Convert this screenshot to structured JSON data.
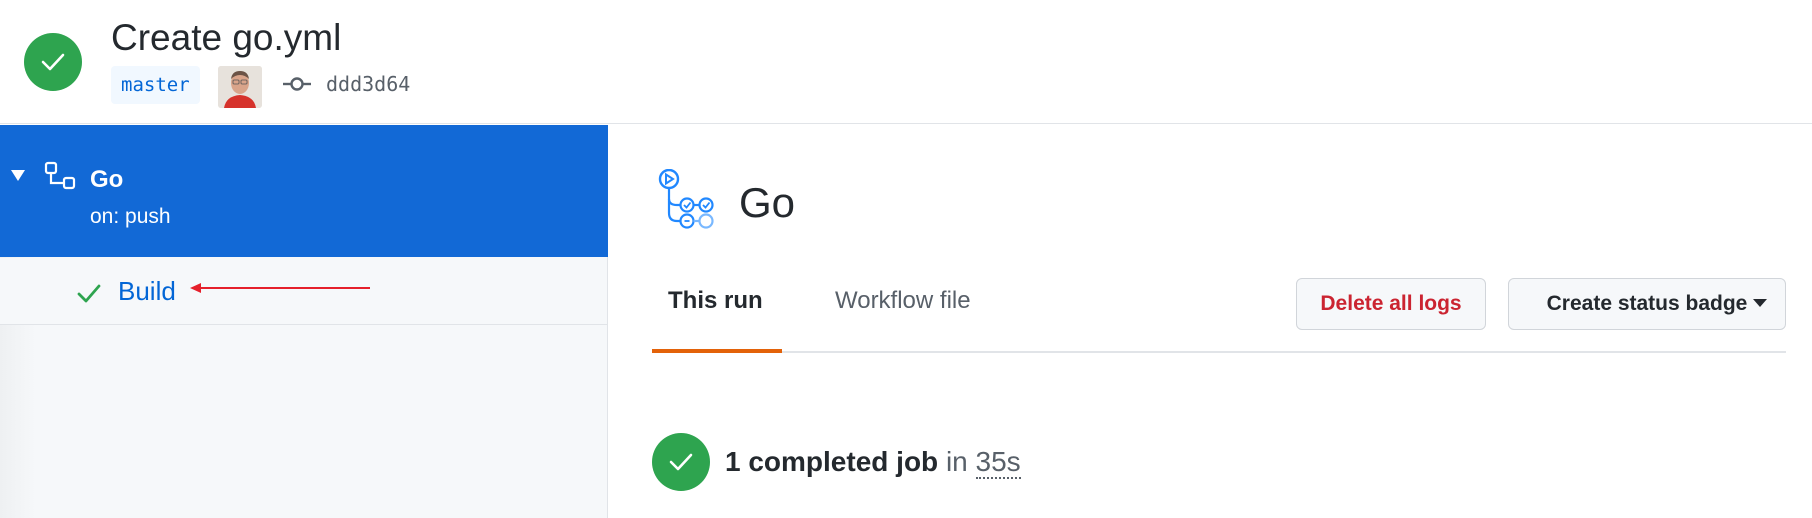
{
  "header": {
    "title": "Create go.yml",
    "branch": "master",
    "commit_sha": "ddd3d64",
    "status_icon": "check-icon",
    "commit_icon": "git-commit-icon"
  },
  "sidebar": {
    "workflow": {
      "name": "Go",
      "trigger": "on: push",
      "icon": "workflow-icon"
    },
    "jobs": [
      {
        "name": "Build",
        "status": "success",
        "icon": "check-icon"
      }
    ]
  },
  "main": {
    "title": "Go",
    "tabs": [
      {
        "label": "This run",
        "active": true
      },
      {
        "label": "Workflow file",
        "active": false
      }
    ],
    "buttons": {
      "delete_logs": "Delete all logs",
      "status_badge": "Create status badge"
    },
    "summary": {
      "count_text": "1 completed job",
      "in_text": "in",
      "duration": "35s"
    }
  },
  "colors": {
    "success": "#2ea44f",
    "selected": "#1269d6",
    "link": "#0366d6",
    "danger": "#cb2431",
    "tab_underline": "#e36209",
    "annotation": "#e5202b"
  }
}
